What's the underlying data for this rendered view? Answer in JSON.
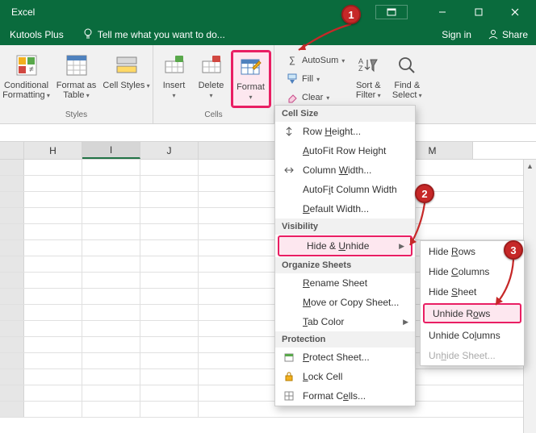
{
  "titlebar": {
    "title": "Excel"
  },
  "tabbar": {
    "kutools_plus": "Kutools Plus",
    "tell_me": "Tell me what you want to do...",
    "sign_in": "Sign in",
    "share": "Share"
  },
  "ribbon": {
    "styles": {
      "label": "Styles",
      "conditional": "Conditional Formatting",
      "format_as_table": "Format as Table",
      "cell_styles": "Cell Styles"
    },
    "cells": {
      "label": "Cells",
      "insert": "Insert",
      "delete": "Delete",
      "format": "Format"
    },
    "editing": {
      "autosum": "AutoSum",
      "fill": "Fill",
      "clear": "Clear",
      "sort_filter": "Sort & Filter",
      "find_select": "Find & Select"
    }
  },
  "columns": [
    "H",
    "I",
    "J",
    "M"
  ],
  "format_menu": {
    "cell_size": "Cell Size",
    "row_height": "Row Height...",
    "autofit_row": "AutoFit Row Height",
    "column_width": "Column Width...",
    "autofit_col": "AutoFit Column Width",
    "default_width": "Default Width...",
    "visibility": "Visibility",
    "hide_unhide": "Hide & Unhide",
    "organize": "Organize Sheets",
    "rename": "Rename Sheet",
    "move_copy": "Move or Copy Sheet...",
    "tab_color": "Tab Color",
    "protection": "Protection",
    "protect_sheet": "Protect Sheet...",
    "lock_cell": "Lock Cell",
    "format_cells": "Format Cells..."
  },
  "submenu": {
    "hide_rows": "Hide Rows",
    "hide_columns": "Hide Columns",
    "hide_sheet": "Hide Sheet",
    "unhide_rows": "Unhide Rows",
    "unhide_columns": "Unhide Columns",
    "unhide_sheet": "Unhide Sheet..."
  },
  "annotations": {
    "a1": "1",
    "a2": "2",
    "a3": "3"
  }
}
